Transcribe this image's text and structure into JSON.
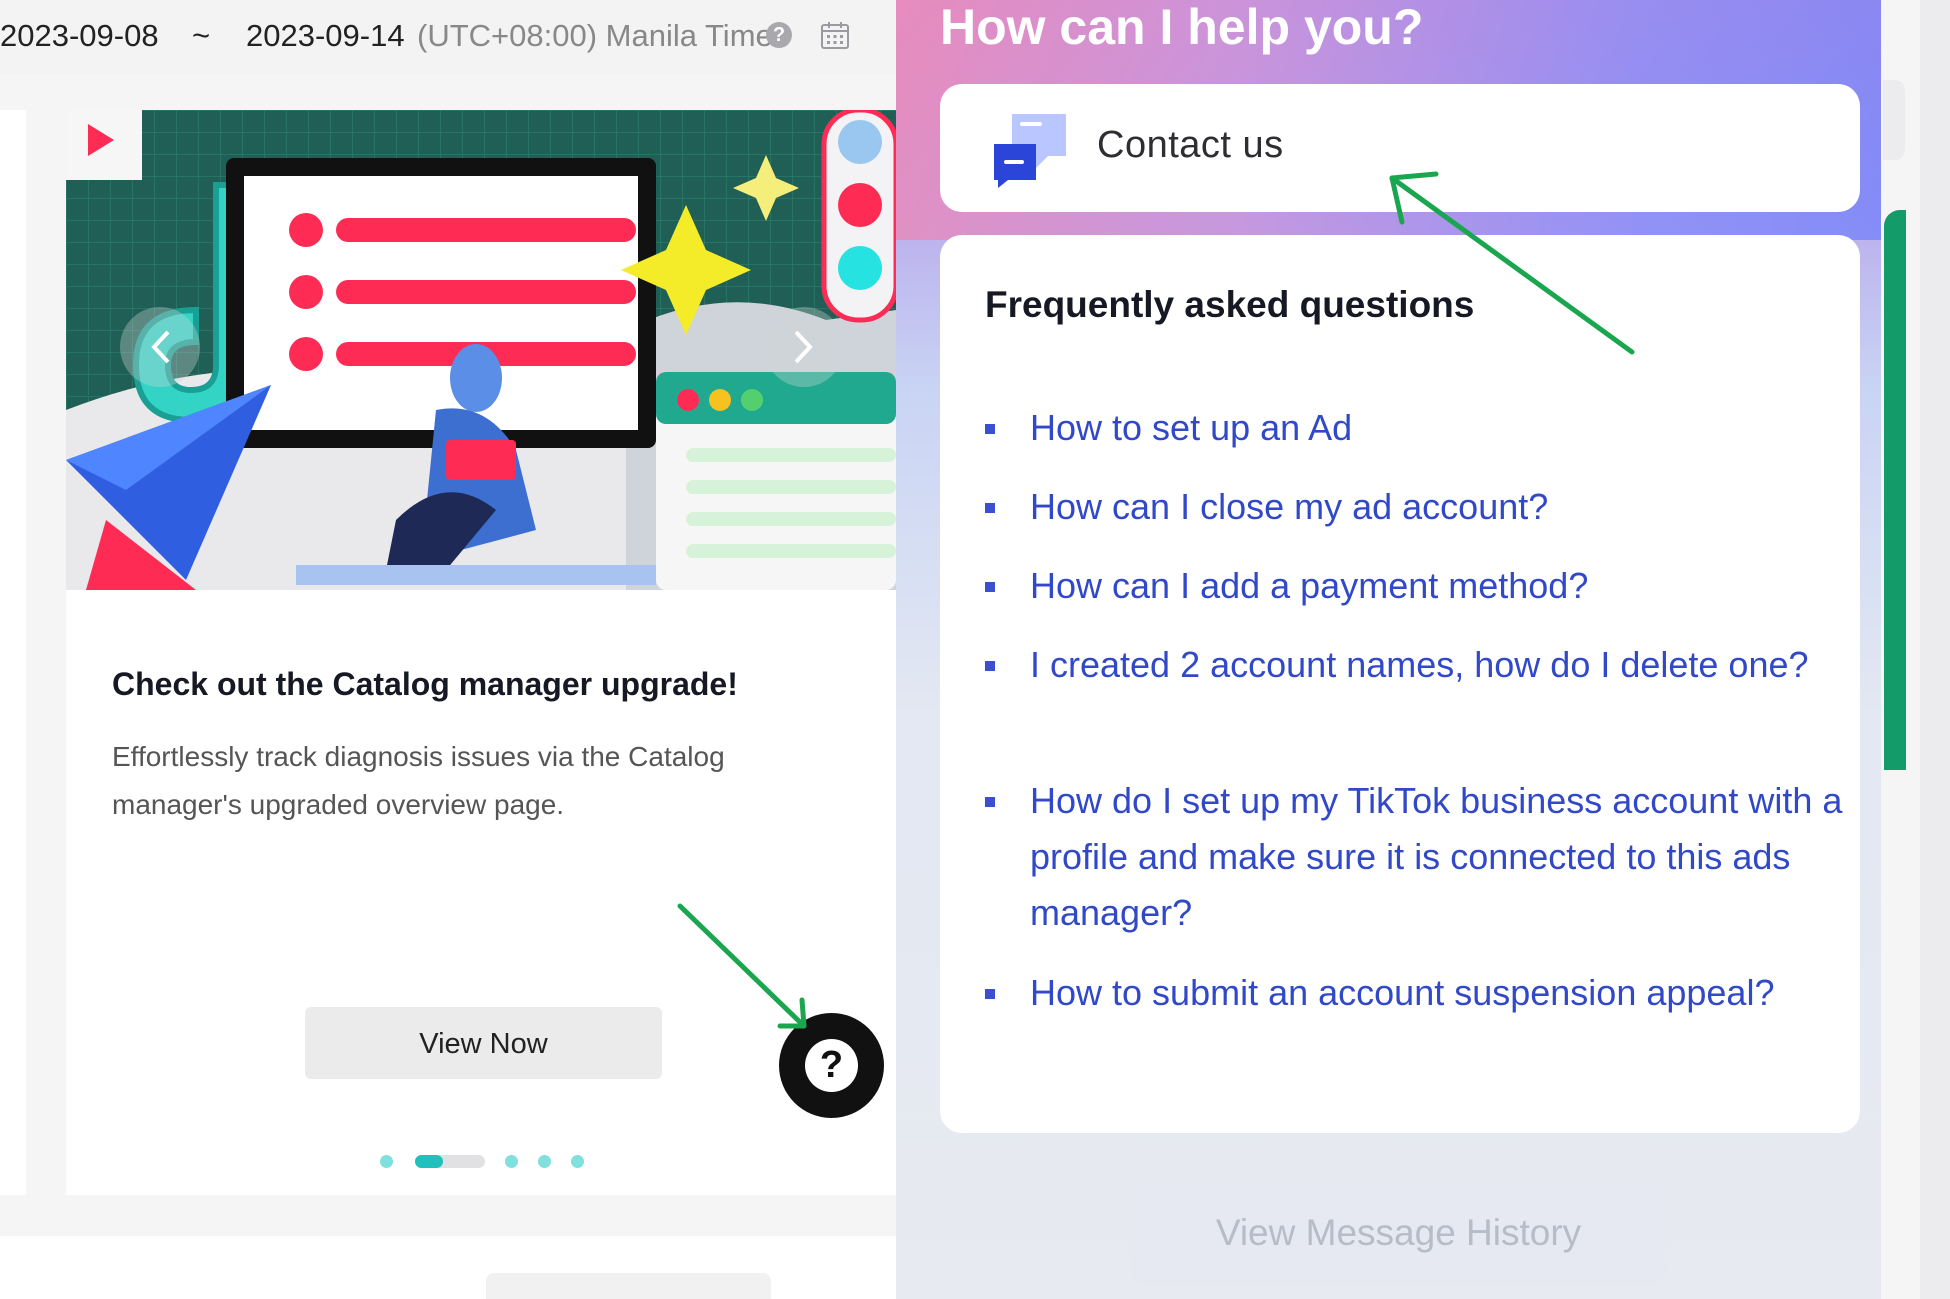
{
  "topbar": {
    "start_date": "2023-09-08",
    "separator": "~",
    "end_date": "2023-09-14",
    "timezone": "(UTC+08:00) Manila Time"
  },
  "promo": {
    "title": "Check out the Catalog manager upgrade!",
    "description": "Effortlessly track diagnosis issues via the Catalog manager's upgraded overview page.",
    "cta_label": "View Now",
    "carousel_total": 5,
    "carousel_active": 2
  },
  "help_fab": {
    "glyph": "?"
  },
  "help_panel": {
    "title": "How can I help you?",
    "contact_label": "Contact us",
    "faq_title": "Frequently asked questions",
    "faq_items": [
      "How to set up an Ad",
      "How can I close my ad account?",
      "How can I add a payment method?",
      "I created 2 account names, how do I delete one?",
      "How do I set up my TikTok business account with a profile and make sure it is connected to this ads manager?",
      "How to submit an account suspension appeal?"
    ],
    "history_label": "View Message History"
  },
  "colors": {
    "link_blue": "#3149c9",
    "annotation_green": "#1aa64f",
    "accent_teal": "#20c0bc",
    "tiktok_red": "#fe2c55"
  },
  "icons": [
    "help-circle-icon",
    "calendar-icon",
    "contact-chat-icon",
    "question-mark-icon",
    "chevron-left-icon",
    "chevron-right-icon"
  ]
}
